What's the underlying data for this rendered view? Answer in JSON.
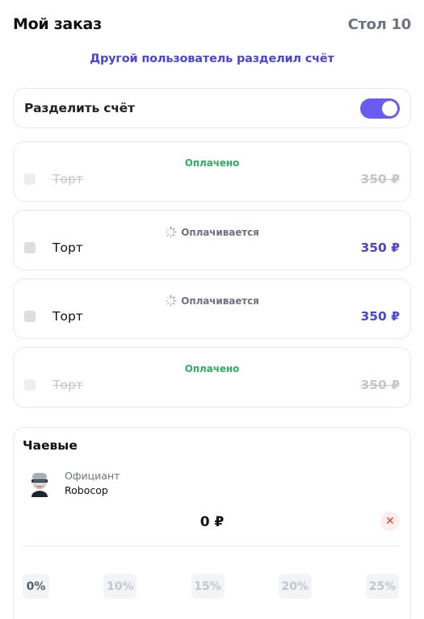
{
  "header": {
    "title": "Мой заказ",
    "table": "Стол 10"
  },
  "split_notice": "Другой пользователь разделил счёт",
  "split_bill": {
    "label": "Разделить счёт",
    "enabled": true,
    "toggle_color": "#6a5cf0"
  },
  "items": [
    {
      "status": "Оплачено",
      "state": "paid",
      "name": "Торт",
      "price": "350 ₽"
    },
    {
      "status": "Оплачивается",
      "state": "paying",
      "name": "Торт",
      "price": "350 ₽"
    },
    {
      "status": "Оплачивается",
      "state": "paying",
      "name": "Торт",
      "price": "350 ₽"
    },
    {
      "status": "Оплачено",
      "state": "paid",
      "name": "Торт",
      "price": "350 ₽"
    }
  ],
  "tips": {
    "title": "Чаевые",
    "waiter": {
      "role": "Официант",
      "name": "Robocop",
      "avatar_icon": "robocop-avatar-icon"
    },
    "amount": "0 ₽",
    "options": [
      "0%",
      "10%",
      "15%",
      "20%",
      "25%"
    ],
    "selected_option": "0%"
  },
  "colors": {
    "accent": "#4b45d6",
    "paid": "#2fae61",
    "muted": "#6e7280",
    "danger": "#e53935"
  }
}
